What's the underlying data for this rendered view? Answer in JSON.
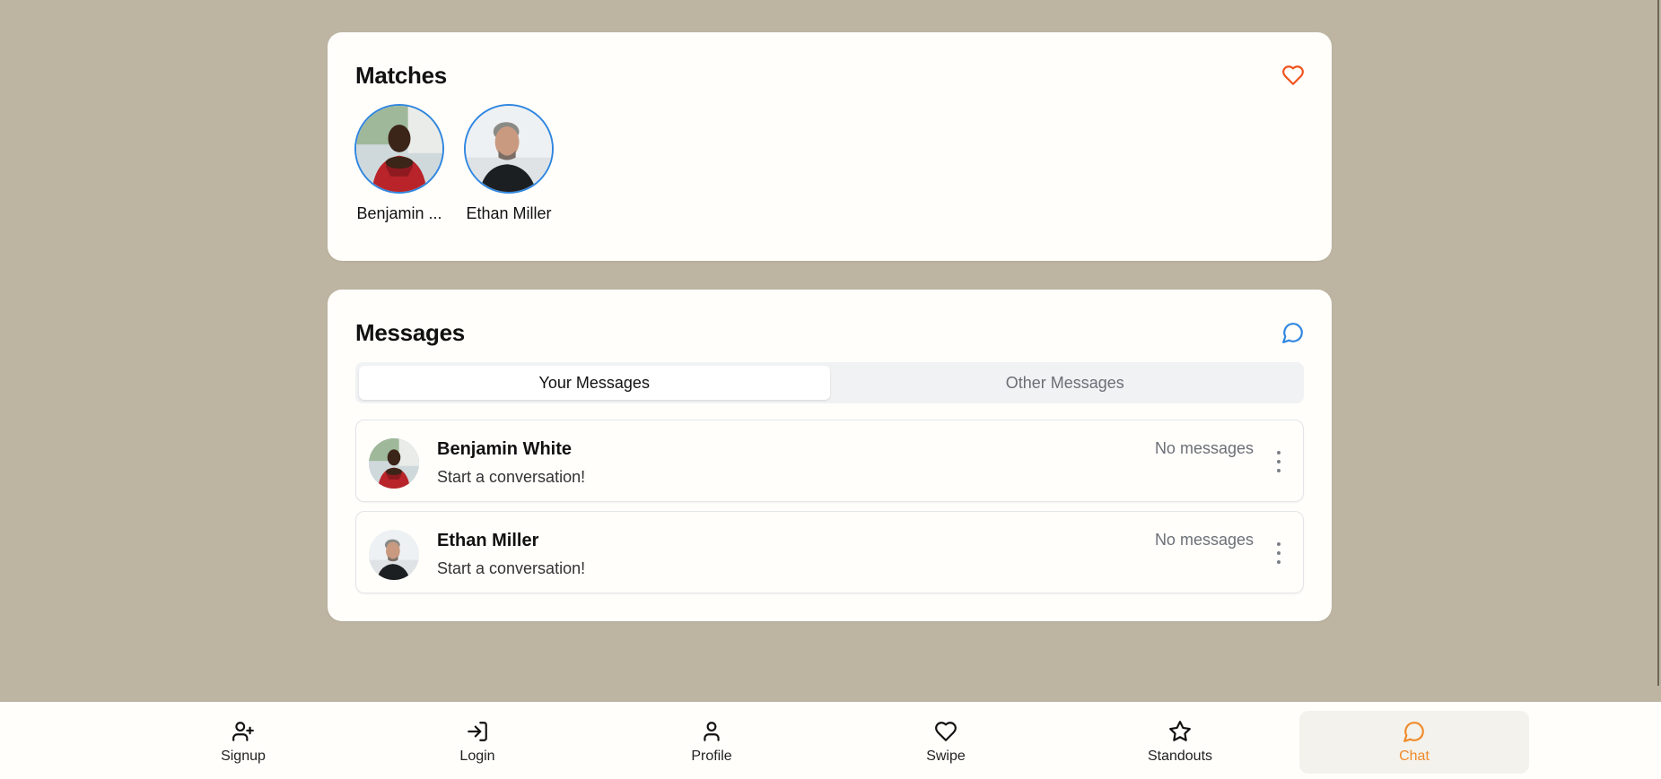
{
  "matches": {
    "title": "Matches",
    "icon": "heart-icon",
    "accent": "#f0541e",
    "items": [
      {
        "name": "Benjamin ...",
        "avatar": "avatar-benjamin"
      },
      {
        "name": "Ethan Miller",
        "avatar": "avatar-ethan"
      }
    ]
  },
  "messages": {
    "title": "Messages",
    "icon": "chat-bubble-icon",
    "accent": "#2f86e0",
    "tabs": [
      {
        "label": "Your Messages",
        "active": true
      },
      {
        "label": "Other Messages",
        "active": false
      }
    ],
    "conversations": [
      {
        "name": "Benjamin White",
        "preview": "Start a conversation!",
        "status": "No messages"
      },
      {
        "name": "Ethan Miller",
        "preview": "Start a conversation!",
        "status": "No messages"
      }
    ]
  },
  "nav": {
    "items": [
      {
        "label": "Signup",
        "icon": "user-plus-icon"
      },
      {
        "label": "Login",
        "icon": "login-icon"
      },
      {
        "label": "Profile",
        "icon": "user-icon"
      },
      {
        "label": "Swipe",
        "icon": "heart-icon"
      },
      {
        "label": "Standouts",
        "icon": "star-icon"
      },
      {
        "label": "Chat",
        "icon": "chat-bubble-icon",
        "active": true
      }
    ],
    "active_color": "#f08a2a"
  }
}
